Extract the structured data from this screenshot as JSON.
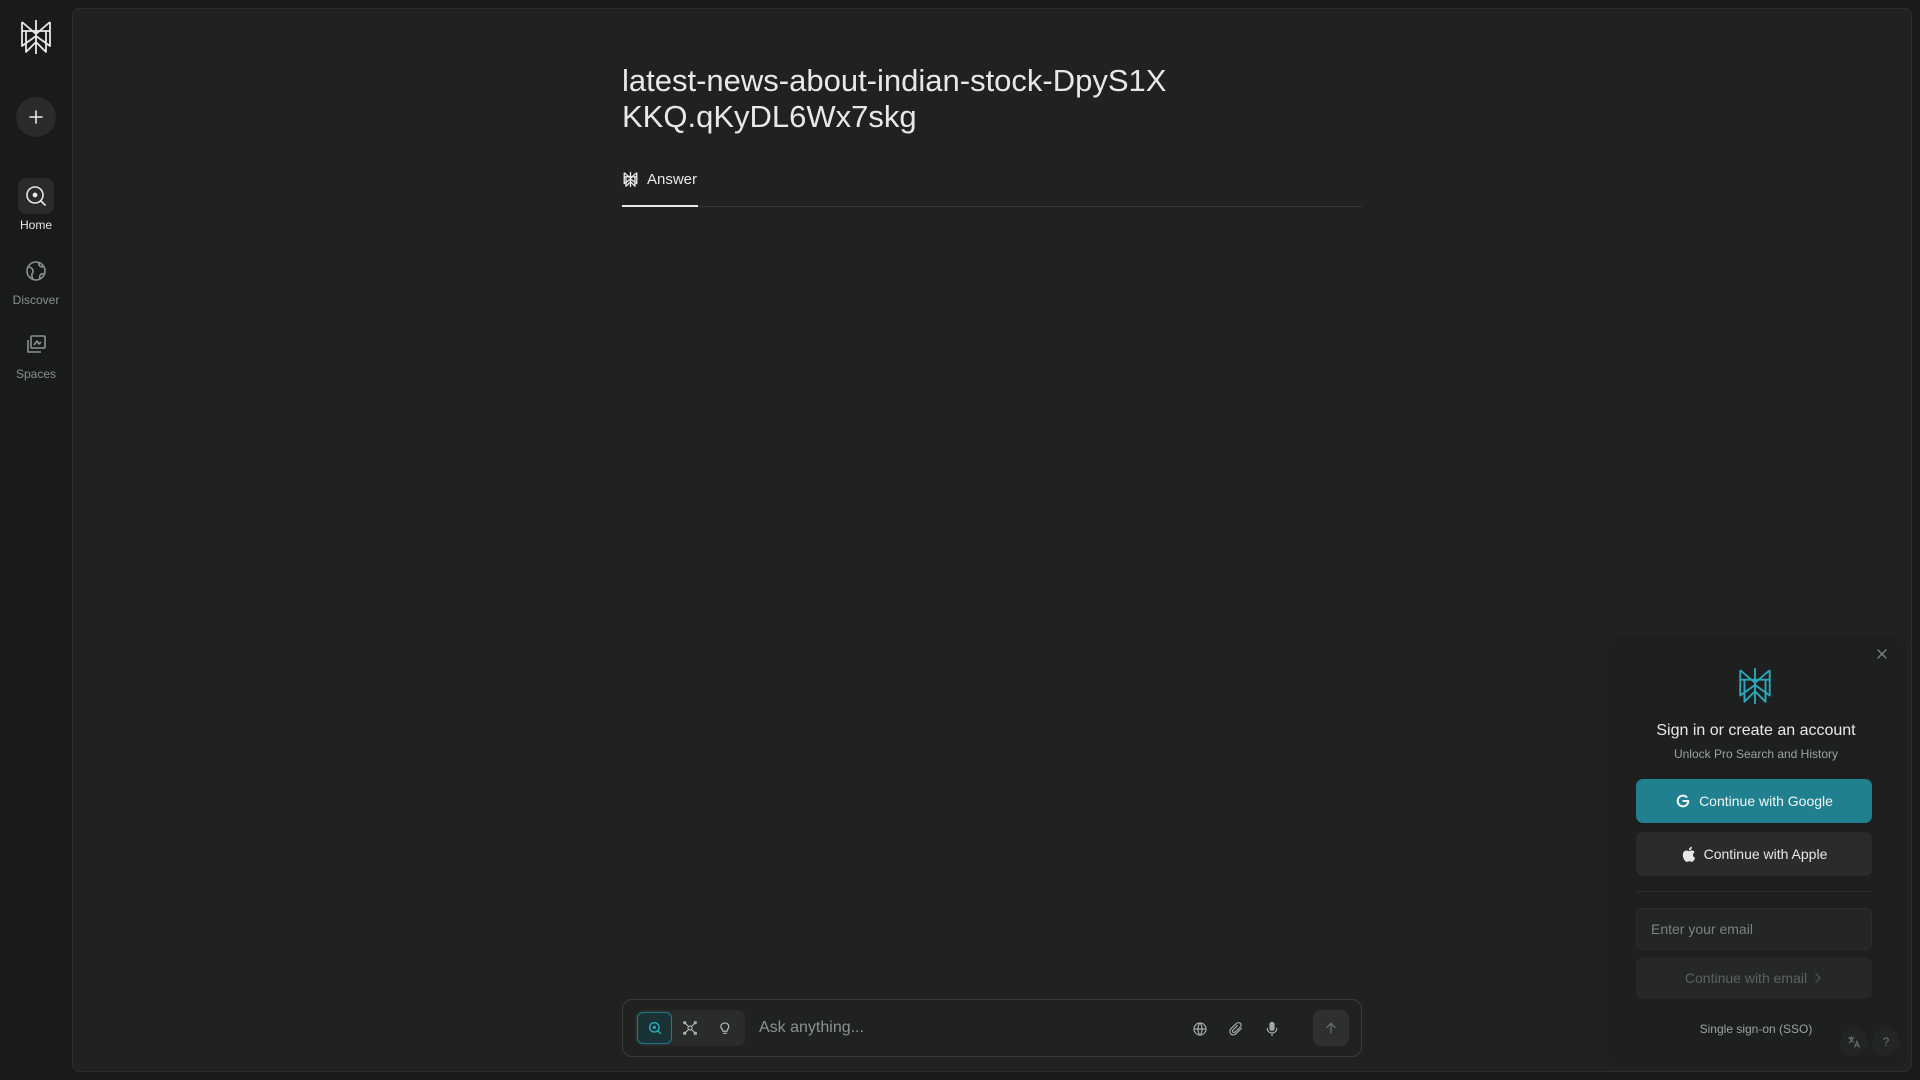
{
  "sidebar": {
    "logo_icon": "perplexity-logo-icon",
    "new_thread_icon": "plus-icon",
    "items": [
      {
        "label": "Home",
        "icon": "search-circle-icon",
        "active": true
      },
      {
        "label": "Discover",
        "icon": "globe-icon",
        "active": false
      },
      {
        "label": "Spaces",
        "icon": "spaces-icon",
        "active": false
      }
    ]
  },
  "thread": {
    "title": "latest-news-about-indian-stock-DpyS1XKKQ.qKyDL6Wx7skg",
    "tabs": [
      {
        "label": "Answer",
        "icon": "perplexity-logo-icon",
        "active": true
      }
    ]
  },
  "composer": {
    "placeholder": "Ask anything...",
    "modes": [
      "search-icon",
      "research-icon",
      "lightbulb-icon"
    ],
    "tools": [
      "globe-icon",
      "paperclip-icon",
      "microphone-icon"
    ],
    "send_icon": "arrow-up-icon"
  },
  "signin": {
    "title": "Sign in or create an account",
    "subtitle": "Unlock Pro Search and History",
    "google_label": "Continue with Google",
    "apple_label": "Continue with Apple",
    "email_placeholder": "Enter your email",
    "email_button_label": "Continue with email",
    "sso_label": "Single sign-on (SSO)",
    "help_label": "?"
  },
  "colors": {
    "accent": "#218090",
    "background": "#191a1a",
    "panel": "#202222",
    "text": "#e8e8e6",
    "muted": "#8d9191"
  }
}
